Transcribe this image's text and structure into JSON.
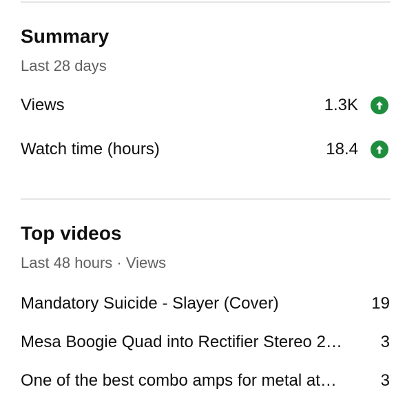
{
  "summary": {
    "title": "Summary",
    "subtitle": "Last 28 days",
    "metrics": [
      {
        "label": "Views",
        "value": "1.3K",
        "trend_icon": "arrow-up-icon",
        "trend_color": "#1e8e3e"
      },
      {
        "label": "Watch time (hours)",
        "value": "18.4",
        "trend_icon": "arrow-up-icon",
        "trend_color": "#1e8e3e"
      }
    ]
  },
  "top_videos": {
    "title": "Top videos",
    "subtitle": "Last 48 hours · Views",
    "items": [
      {
        "title": "Mandatory Suicide - Slayer (Cover)",
        "views": "19"
      },
      {
        "title": "Mesa Boogie Quad into Rectifier Stereo 2…",
        "views": "3"
      },
      {
        "title": "One of the best combo amps for metal at…",
        "views": "3"
      }
    ]
  }
}
